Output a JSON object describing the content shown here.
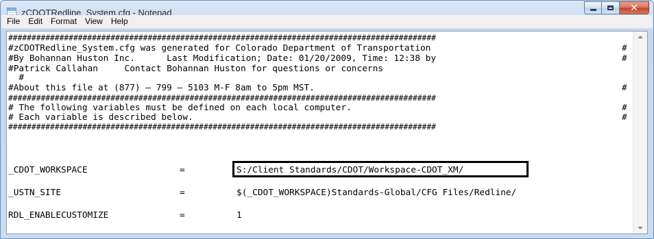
{
  "window": {
    "title": "zCDOTRedline_System.cfg - Notepad",
    "close_glyph": "✕"
  },
  "menu": [
    "File",
    "Edit",
    "Format",
    "View",
    "Help"
  ],
  "editor": {
    "lines": [
      "############################################################################################",
      "#zCDOTRedline_System.cfg was generated for Colorado Department of Transportation",
      "#By Bohannan Huston Inc.      Last Modification; Date: 01/20/2009, Time: 12:38 by",
      "#Patrick Callahan     Contact Bohannan Huston for questions or concerns",
      "  #",
      "#About this file at (877) – 799 – 5103 M-F 8am to 5pm MST.",
      "############################################################################################",
      "# The following variables must be defined on each local computer.",
      "# Each variable is described below.",
      "############################################################################################"
    ],
    "right_hashes": [
      "#",
      "#",
      "#",
      "#",
      "#"
    ],
    "variables": [
      {
        "name": "_CDOT_WORKSPACE",
        "op": "=",
        "value": "S:/Client Standards/CDOT/Workspace-CDOT_XM/"
      },
      {
        "name": "_USTN_SITE",
        "op": "=",
        "value": "$(_CDOT_WORKSPACE)Standards-Global/CFG Files/Redline/"
      },
      {
        "name": "RDL_ENABLECUSTOMIZE",
        "op": "=",
        "value": "1"
      }
    ]
  }
}
